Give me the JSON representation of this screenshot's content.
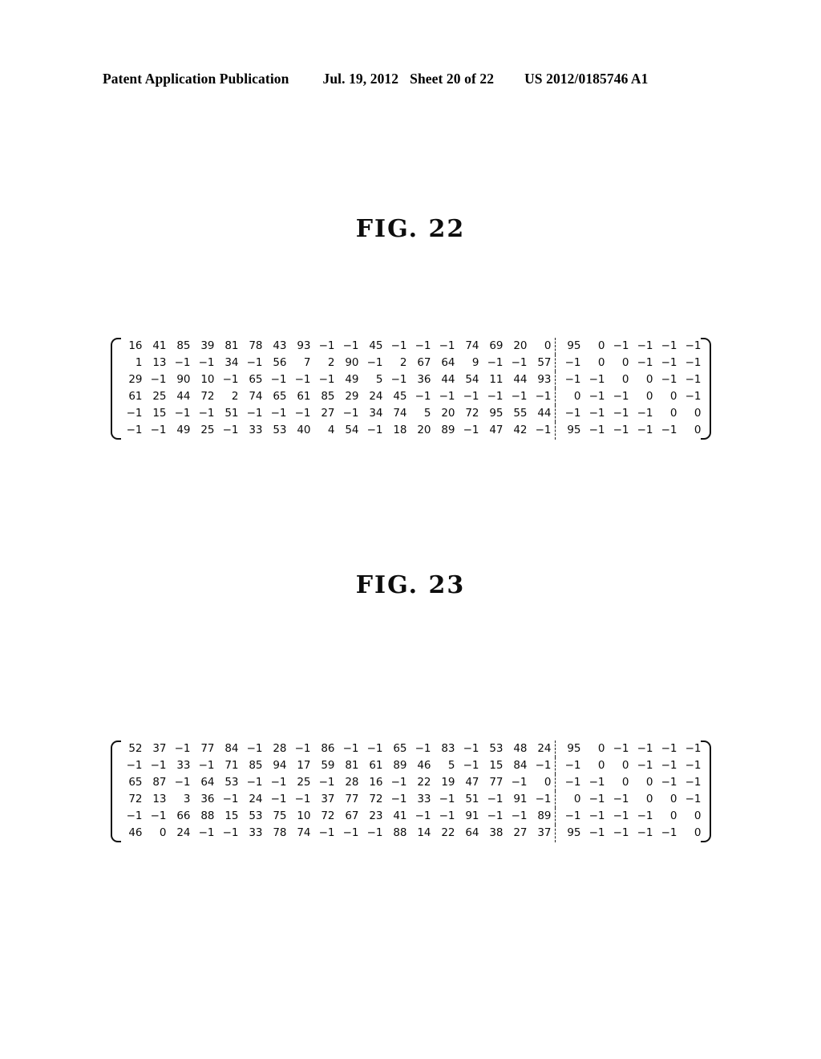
{
  "header": {
    "publication": "Patent Application Publication",
    "date": "Jul. 19, 2012",
    "sheet": "Sheet 20 of 22",
    "patent_number": "US 2012/0185746 A1"
  },
  "figures": [
    {
      "id": "fig-22",
      "title": "FIG. 22",
      "matrix": {
        "rows": 6,
        "cols": 24,
        "split_after_col": 18,
        "separator": "dashed",
        "bracket": "square",
        "values": [
          [
            16,
            41,
            85,
            39,
            81,
            78,
            43,
            93,
            -1,
            -1,
            45,
            -1,
            -1,
            -1,
            74,
            69,
            20,
            0,
            95,
            0,
            -1,
            -1,
            -1,
            -1
          ],
          [
            1,
            13,
            -1,
            -1,
            34,
            -1,
            56,
            7,
            2,
            90,
            -1,
            2,
            67,
            64,
            9,
            -1,
            -1,
            57,
            -1,
            0,
            0,
            -1,
            -1,
            -1
          ],
          [
            29,
            -1,
            90,
            10,
            -1,
            65,
            -1,
            -1,
            -1,
            49,
            5,
            -1,
            36,
            44,
            54,
            11,
            44,
            93,
            -1,
            -1,
            0,
            0,
            -1,
            -1
          ],
          [
            61,
            25,
            44,
            72,
            2,
            74,
            65,
            61,
            85,
            29,
            24,
            45,
            -1,
            -1,
            -1,
            -1,
            -1,
            -1,
            0,
            -1,
            -1,
            0,
            0,
            -1
          ],
          [
            -1,
            15,
            -1,
            -1,
            51,
            -1,
            -1,
            -1,
            27,
            -1,
            34,
            74,
            5,
            20,
            72,
            95,
            55,
            44,
            -1,
            -1,
            -1,
            -1,
            0,
            0
          ],
          [
            -1,
            -1,
            49,
            25,
            -1,
            33,
            53,
            40,
            4,
            54,
            -1,
            18,
            20,
            89,
            -1,
            47,
            42,
            -1,
            95,
            -1,
            -1,
            -1,
            -1,
            0
          ]
        ]
      }
    },
    {
      "id": "fig-23",
      "title": "FIG. 23",
      "matrix": {
        "rows": 6,
        "cols": 24,
        "split_after_col": 18,
        "separator": "dashed",
        "bracket": "square",
        "values": [
          [
            52,
            37,
            -1,
            77,
            84,
            -1,
            28,
            -1,
            86,
            -1,
            -1,
            65,
            -1,
            83,
            -1,
            53,
            48,
            24,
            95,
            0,
            -1,
            -1,
            -1,
            -1
          ],
          [
            -1,
            -1,
            33,
            -1,
            71,
            85,
            94,
            17,
            59,
            81,
            61,
            89,
            46,
            5,
            -1,
            15,
            84,
            -1,
            -1,
            0,
            0,
            -1,
            -1,
            -1
          ],
          [
            65,
            87,
            -1,
            64,
            53,
            -1,
            -1,
            25,
            -1,
            28,
            16,
            -1,
            22,
            19,
            47,
            77,
            -1,
            0,
            -1,
            -1,
            0,
            0,
            -1,
            -1
          ],
          [
            72,
            13,
            3,
            36,
            -1,
            24,
            -1,
            -1,
            37,
            77,
            72,
            -1,
            33,
            -1,
            51,
            -1,
            91,
            -1,
            0,
            -1,
            -1,
            0,
            0,
            -1
          ],
          [
            -1,
            -1,
            66,
            88,
            15,
            53,
            75,
            10,
            72,
            67,
            23,
            41,
            -1,
            -1,
            91,
            -1,
            -1,
            89,
            -1,
            -1,
            -1,
            -1,
            0,
            0
          ],
          [
            46,
            0,
            24,
            -1,
            -1,
            33,
            78,
            74,
            -1,
            -1,
            -1,
            88,
            14,
            22,
            64,
            38,
            27,
            37,
            95,
            -1,
            -1,
            -1,
            -1,
            0
          ]
        ]
      }
    }
  ]
}
